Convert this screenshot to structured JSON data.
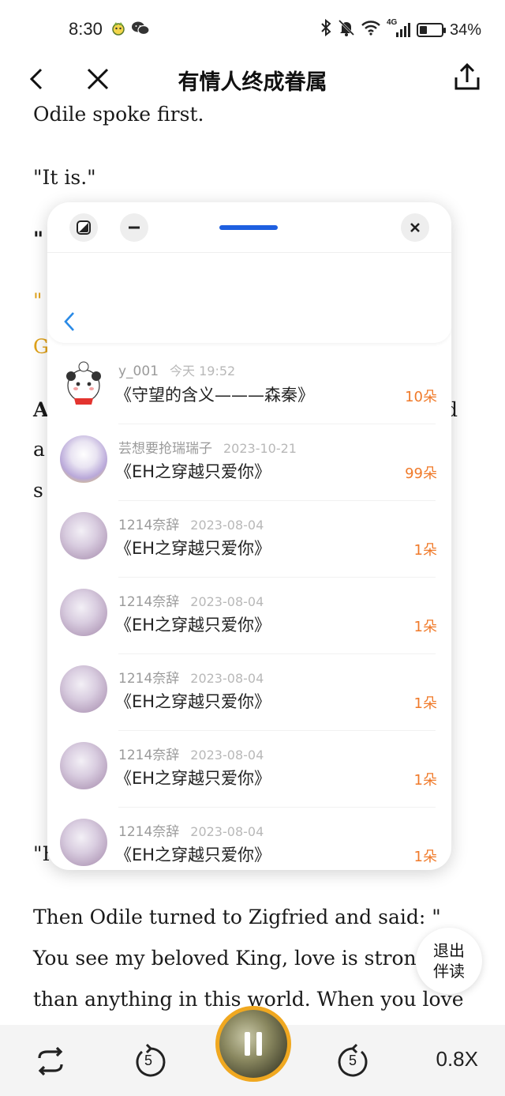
{
  "status_bar": {
    "time": "8:30",
    "battery_text": "34%",
    "battery_level": 0.34,
    "network_label": "4G"
  },
  "header": {
    "title": "有情人终成眷属"
  },
  "reader": {
    "paragraphs": [
      "Odile spoke first.",
      "\"It is.\"",
      "\"",
      "\"",
      "G",
      "A",
      "a",
      "s"
    ],
    "right_fragment": "d",
    "bottom_quote_fragment": "\"H",
    "bottom_lines": [
      "Then Odile turned to Zigfried and said: \"",
      "You see my beloved King, love is strong",
      "than anything in this world. When you love"
    ]
  },
  "panel": {
    "gifts": [
      {
        "user": "y_001",
        "time": "今天 19:52",
        "book": "《守望的含义———森秦》",
        "count": "10朵",
        "avatar": "panda"
      },
      {
        "user": "芸想要抢瑞瑞子",
        "time": "2023-10-21",
        "book": "《EH之穿越只爱你》",
        "count": "99朵",
        "avatar": "anime"
      },
      {
        "user": "1214奈辞",
        "time": "2023-08-04",
        "book": "《EH之穿越只爱你》",
        "count": "1朵",
        "avatar": "purple"
      },
      {
        "user": "1214奈辞",
        "time": "2023-08-04",
        "book": "《EH之穿越只爱你》",
        "count": "1朵",
        "avatar": "purple"
      },
      {
        "user": "1214奈辞",
        "time": "2023-08-04",
        "book": "《EH之穿越只爱你》",
        "count": "1朵",
        "avatar": "purple"
      },
      {
        "user": "1214奈辞",
        "time": "2023-08-04",
        "book": "《EH之穿越只爱你》",
        "count": "1朵",
        "avatar": "purple"
      },
      {
        "user": "1214奈辞",
        "time": "2023-08-04",
        "book": "《EH之穿越只爱你》",
        "count": "1朵",
        "avatar": "purple"
      }
    ]
  },
  "companion": {
    "exit_label_line1": "退出",
    "exit_label_line2": "伴读"
  },
  "player": {
    "rewind_seconds": "5",
    "forward_seconds": "5",
    "speed": "0.8X"
  },
  "colors": {
    "accent_orange": "#f07a2a",
    "accent_gold": "#e0a21a",
    "handle_blue": "#1e5fe0",
    "play_ring": "#f0a820"
  }
}
